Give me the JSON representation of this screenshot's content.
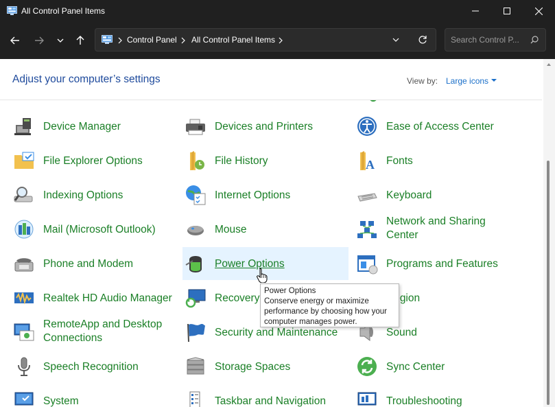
{
  "window": {
    "title": "All Control Panel Items"
  },
  "nav": {
    "breadcrumbs": [
      "Control Panel",
      "All Control Panel Items"
    ],
    "search_placeholder": "Search Control P..."
  },
  "header": {
    "title": "Adjust your computer’s settings",
    "view_by_label": "View by:",
    "view_by_value": "Large icons"
  },
  "items": {
    "device_manager": "Device Manager",
    "devices_printers": "Devices and Printers",
    "ease_of_access": "Ease of Access Center",
    "file_explorer": "File Explorer Options",
    "file_history": "File History",
    "fonts": "Fonts",
    "indexing": "Indexing Options",
    "internet_options": "Internet Options",
    "keyboard": "Keyboard",
    "mail": "Mail (Microsoft Outlook)",
    "mouse": "Mouse",
    "network_sharing": "Network and Sharing Center",
    "phone_modem": "Phone and Modem",
    "power_options": "Power Options",
    "programs_features": "Programs and Features",
    "realtek": "Realtek HD Audio Manager",
    "recovery": "Recovery",
    "region": "Region",
    "remoteapp": "RemoteApp and Desktop Connections",
    "security_maintenance": "Security and Maintenance",
    "sound": "Sound",
    "speech": "Speech Recognition",
    "storage_spaces": "Storage Spaces",
    "sync_center": "Sync Center",
    "system": "System",
    "taskbar_navigation": "Taskbar and Navigation",
    "troubleshooting": "Troubleshooting"
  },
  "tooltip": {
    "title": "Power Options",
    "body": "Conserve energy or maximize performance by choosing how your computer manages power."
  },
  "colors": {
    "titlebar_bg": "#202020",
    "link_green": "#1a7f26",
    "heading_blue": "#1e4a9c",
    "hover_bg": "#e5f3ff"
  }
}
